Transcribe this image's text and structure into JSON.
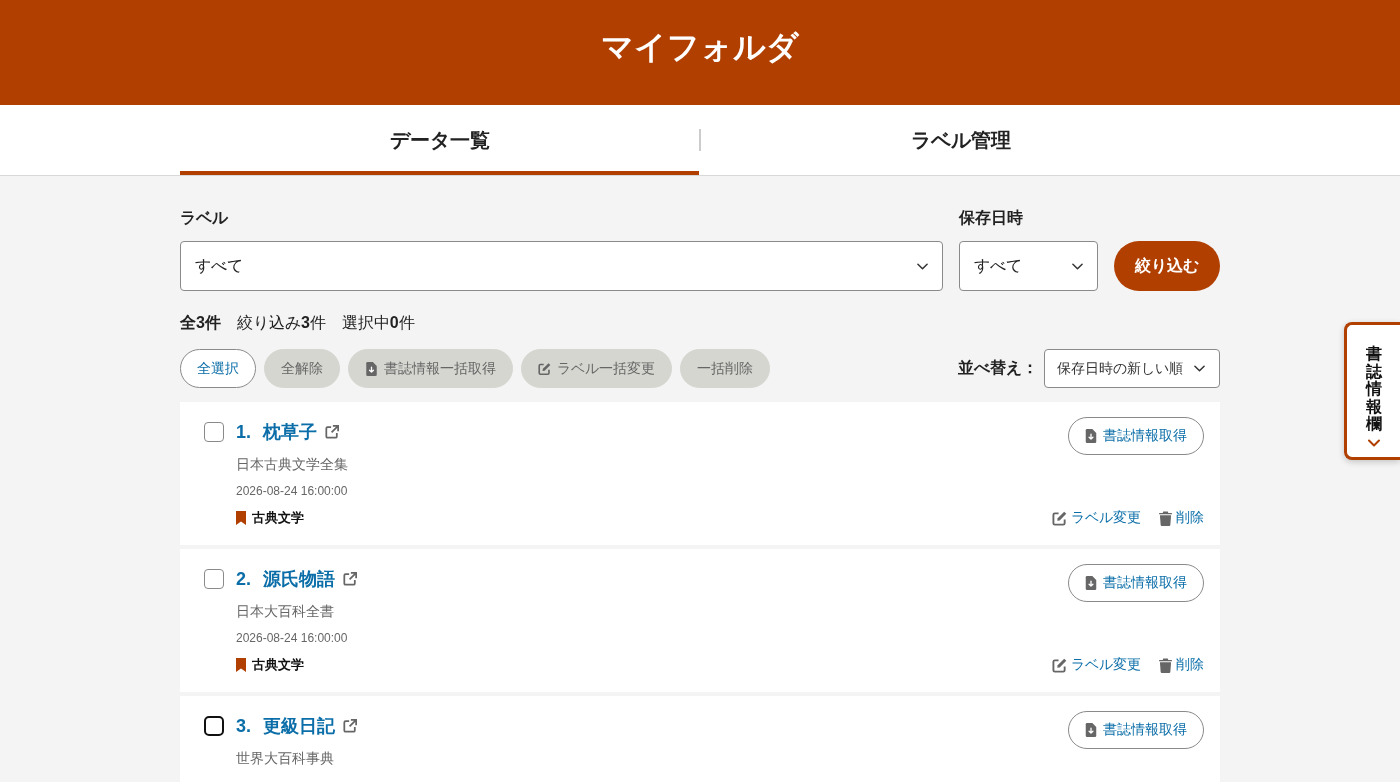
{
  "header": {
    "title": "マイフォルダ"
  },
  "tabs": [
    {
      "label": "データ一覧",
      "selected": true
    },
    {
      "label": "ラベル管理",
      "selected": false
    }
  ],
  "filters": {
    "label_filter": {
      "label": "ラベル",
      "value": "すべて"
    },
    "date_filter": {
      "label": "保存日時",
      "value": "すべて"
    },
    "apply_button": "絞り込む"
  },
  "counts": [
    {
      "text": "全**3**件",
      "emphasis": true
    },
    {
      "text": "絞り込み**3**件",
      "emphasis": false
    },
    {
      "text": "選択中**0**件",
      "emphasis": false
    }
  ],
  "bulk_actions": [
    {
      "kind": "plain",
      "label": "全選択",
      "disabled": false
    },
    {
      "kind": "plain",
      "label": "全解除",
      "disabled": true
    },
    {
      "kind": "download",
      "label": "書誌情報一括取得",
      "disabled": true
    },
    {
      "kind": "edit",
      "label": "ラベル一括変更",
      "disabled": true
    },
    {
      "kind": "plain",
      "label": "一括削除",
      "disabled": true
    }
  ],
  "sort": {
    "label": "並べ替え：",
    "value": "保存日時の新しい順"
  },
  "items": [
    {
      "number": "1.",
      "title": "枕草子",
      "source": "日本古典文学全集",
      "saved_at": "2026-08-24 16:00:00",
      "label": "古典文学",
      "checked": false,
      "focused": false,
      "fetch_button": "書誌情報取得",
      "actions": [
        {
          "kind": "edit",
          "label": "ラベル変更"
        },
        {
          "kind": "delete",
          "label": "削除"
        }
      ]
    },
    {
      "number": "2.",
      "title": "源氏物語",
      "source": "日本大百科全書",
      "saved_at": "2026-08-24 16:00:00",
      "label": "古典文学",
      "checked": false,
      "focused": false,
      "fetch_button": "書誌情報取得",
      "actions": [
        {
          "kind": "edit",
          "label": "ラベル変更"
        },
        {
          "kind": "delete",
          "label": "削除"
        }
      ]
    },
    {
      "number": "3.",
      "title": "更級日記",
      "source": "世界大百科事典",
      "checked": false,
      "focused": true,
      "fetch_button": "書誌情報取得"
    }
  ],
  "side_panel": {
    "label": "書誌情報欄",
    "expanded": false
  }
}
